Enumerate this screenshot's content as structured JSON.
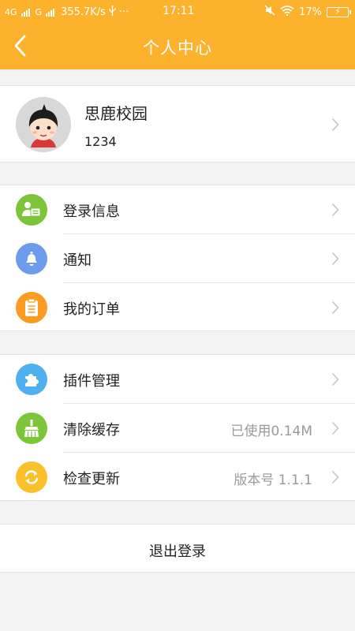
{
  "status_bar": {
    "net1": "4G",
    "net2": "G",
    "speed": "355.7K/s",
    "dots": "···",
    "time": "17:11",
    "battery": "17%"
  },
  "header": {
    "title": "个人中心",
    "back_icon": "chevron-left-icon",
    "color": "#fdb22e"
  },
  "profile": {
    "name": "思鹿校园",
    "id": "1234"
  },
  "menu_group_1": [
    {
      "label": "登录信息",
      "icon": "id-card-icon",
      "color": "#7cc438"
    },
    {
      "label": "通知",
      "icon": "bell-icon",
      "color": "#6d9ceb"
    },
    {
      "label": "我的订单",
      "icon": "clipboard-icon",
      "color": "#fb9b1f"
    }
  ],
  "menu_group_2": [
    {
      "label": "插件管理",
      "icon": "puzzle-icon",
      "color": "#4fb0ef",
      "value": ""
    },
    {
      "label": "清除缓存",
      "icon": "broom-icon",
      "color": "#7cc438",
      "value": "已使用0.14M"
    },
    {
      "label": "检查更新",
      "icon": "refresh-icon",
      "color": "#fbc12b",
      "value": "版本号 1.1.1"
    }
  ],
  "logout_label": "退出登录"
}
